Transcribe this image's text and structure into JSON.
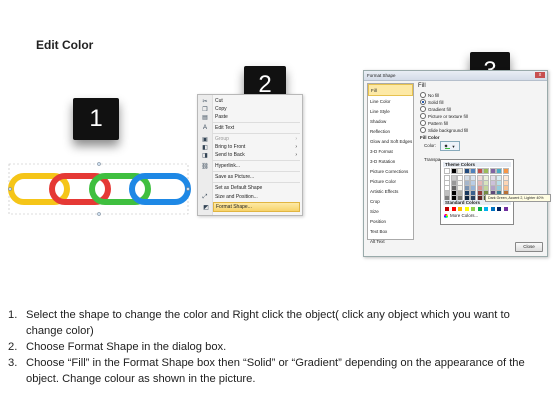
{
  "title": "Edit Color",
  "badges": [
    "1",
    "2",
    "3"
  ],
  "chain_colors": [
    "#f5c518",
    "#e53935",
    "#3fbf3f",
    "#1e88e5"
  ],
  "context_menu": {
    "items": [
      {
        "label": "Cut",
        "icon": "scissors-icon"
      },
      {
        "label": "Copy",
        "icon": "copy-icon"
      },
      {
        "label": "Paste",
        "icon": "paste-icon"
      },
      {
        "label": "Edit Text",
        "icon": "edit-text-icon"
      },
      {
        "label": "Group",
        "icon": "group-icon"
      },
      {
        "label": "Bring to Front",
        "icon": "bring-front-icon"
      },
      {
        "label": "Send to Back",
        "icon": "send-back-icon"
      },
      {
        "label": "Hyperlink...",
        "icon": "hyperlink-icon"
      },
      {
        "label": "Save as Picture...",
        "icon": ""
      },
      {
        "label": "Set as Default Shape",
        "icon": ""
      },
      {
        "label": "Size and Position...",
        "icon": "size-icon"
      },
      {
        "label": "Format Shape...",
        "icon": "format-shape-icon"
      }
    ]
  },
  "dialog": {
    "title": "Format Shape",
    "close_x": "x",
    "nav": [
      "Fill",
      "Line Color",
      "Line Style",
      "Shadow",
      "Reflection",
      "Glow and Soft Edges",
      "3-D Format",
      "3-D Rotation",
      "Picture Corrections",
      "Picture Color",
      "Artistic Effects",
      "Crop",
      "Size",
      "Position",
      "Text Box",
      "Alt Text"
    ],
    "section": "Fill",
    "options": [
      "No fill",
      "Solid fill",
      "Gradient fill",
      "Picture or texture fill",
      "Pattern fill",
      "Slide background fill"
    ],
    "fill_color_label": "Fill Color",
    "color_label": "Color:",
    "transparency_label": "Transpa",
    "close_button": "Close",
    "palette": {
      "theme_header": "Theme Colors",
      "standard_header": "Standard Colors",
      "more": "More Colors...",
      "tooltip": "Dark Green, Accent 2, Lighter 40%",
      "theme_colors": [
        "#ffffff",
        "#000000",
        "#eeece1",
        "#1f497d",
        "#4f81bd",
        "#c0504d",
        "#9bbb59",
        "#8064a2",
        "#4bacc6",
        "#f79646"
      ],
      "standard_colors": [
        "#c00000",
        "#ff0000",
        "#ffc000",
        "#ffff00",
        "#92d050",
        "#00b050",
        "#00b0f0",
        "#0070c0",
        "#002060",
        "#7030a0"
      ]
    }
  },
  "steps": [
    {
      "n": "1.",
      "text": "Select the shape to change the color and Right click the object( click any object which you want to change color)"
    },
    {
      "n": "2.",
      "text": "Choose Format Shape in the dialog box."
    },
    {
      "n": "3.",
      "text": "Choose “Fill” in the Format Shape box then “Solid” or “Gradient” depending on the appearance of the object. Change colour as shown in the picture."
    }
  ]
}
